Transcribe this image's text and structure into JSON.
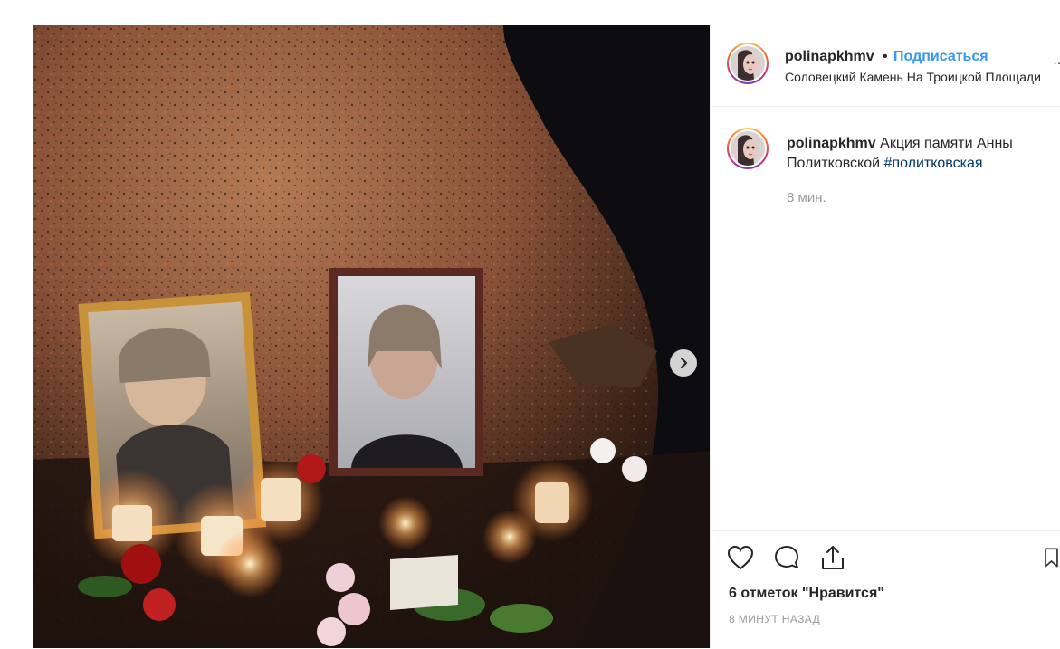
{
  "post": {
    "username": "polinapkhmv",
    "follow_label": "Подписаться",
    "location": "Соловецкий Камень На Троицкой Площади",
    "caption_user": "polinapkhmv",
    "caption_text": "Акция памяти Анны Политковской",
    "hashtag": "#политковская",
    "time_ago": "8 мин.",
    "likes": "6 отметок \"Нравится\"",
    "posted": "8 МИНУТ НАЗАД"
  },
  "icons": {
    "next": "chevron-right-icon",
    "like": "heart-icon",
    "comment": "comment-icon",
    "share": "share-icon",
    "save": "bookmark-icon",
    "more": "more-dots-icon"
  },
  "colors": {
    "link_blue": "#3897f0",
    "hashtag": "#003569",
    "text": "#262626",
    "muted": "#999999"
  }
}
